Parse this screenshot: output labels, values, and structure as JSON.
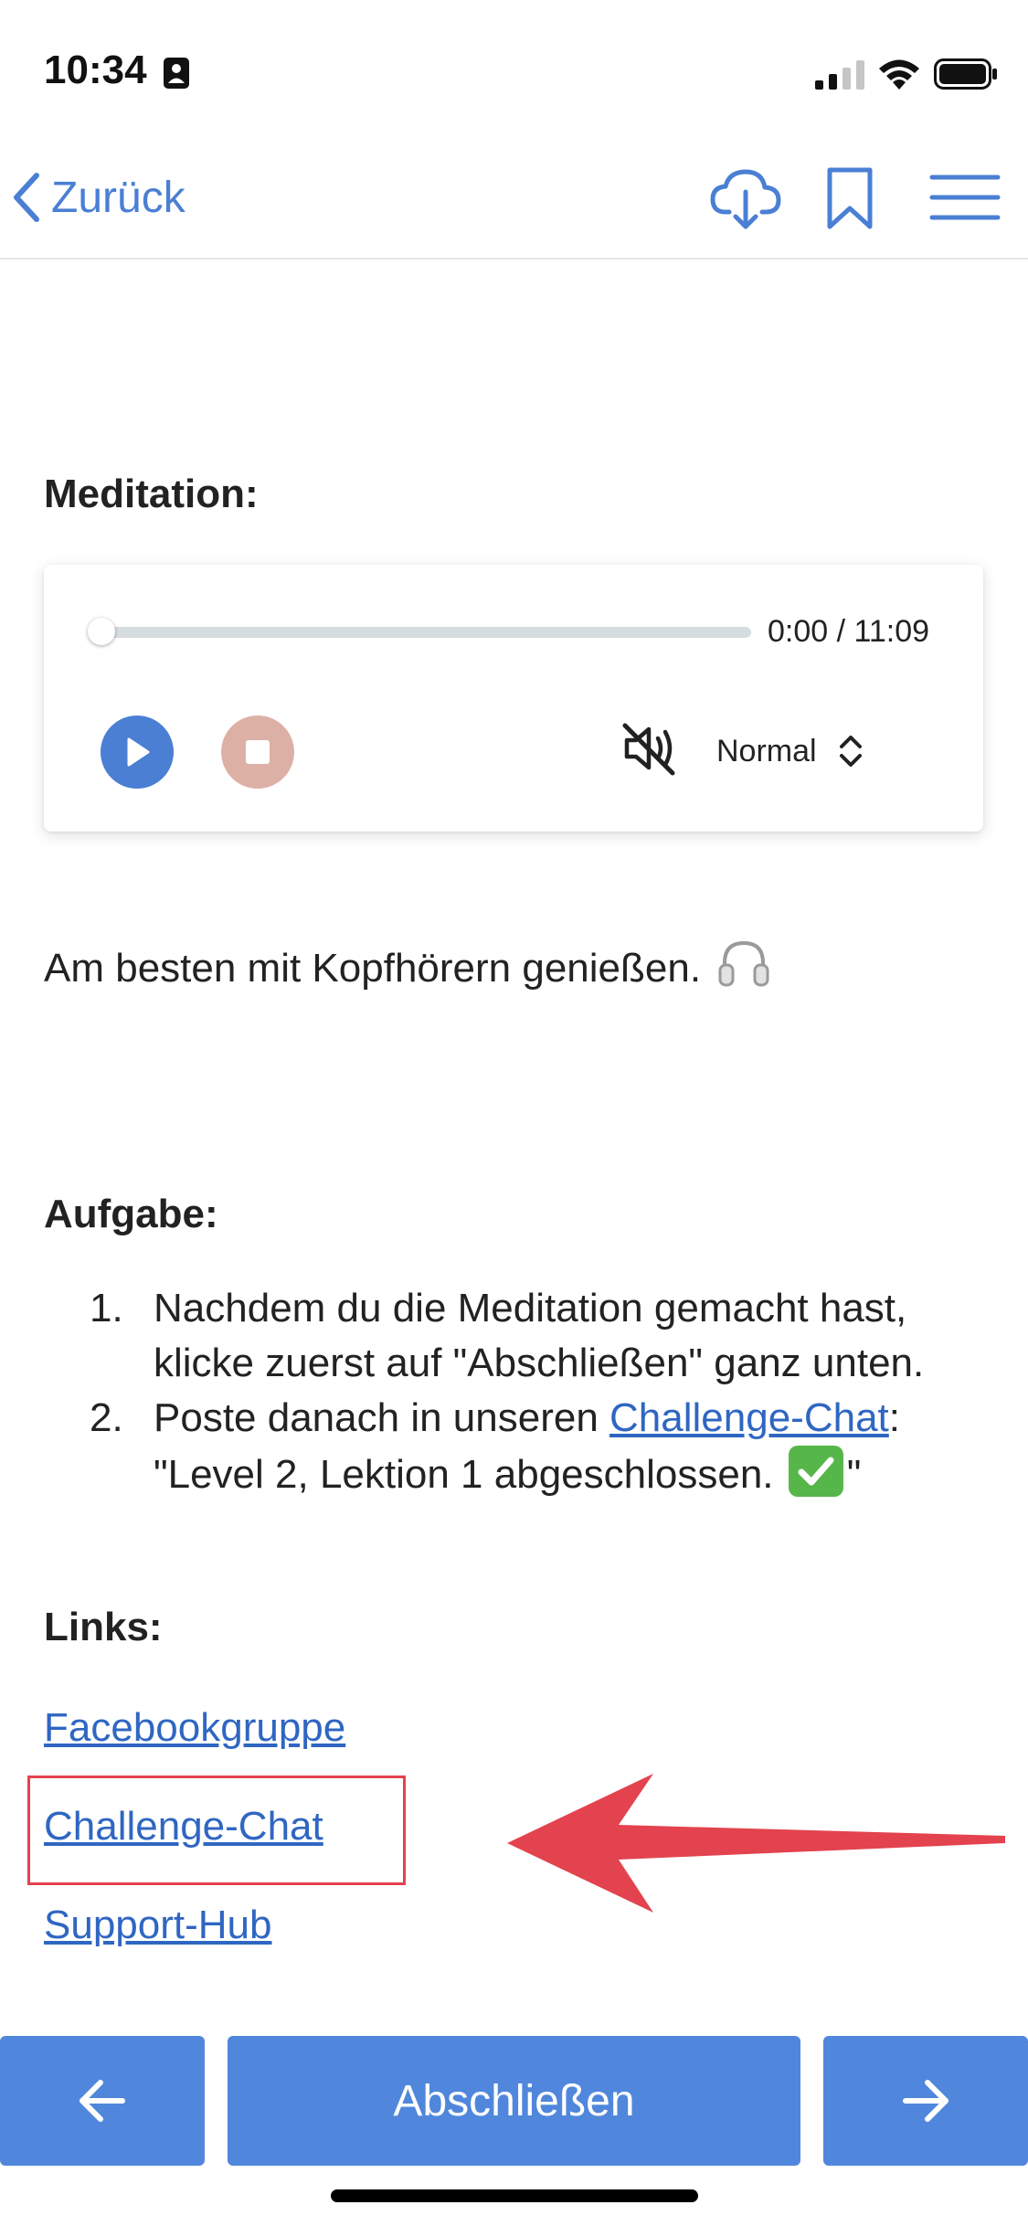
{
  "status_bar": {
    "time": "10:34"
  },
  "nav": {
    "back_label": "Zurück",
    "icons": [
      "cloud-download-icon",
      "bookmark-icon",
      "menu-icon"
    ],
    "accent_color": "#4a7fd4"
  },
  "meditation": {
    "heading": "Meditation:",
    "player": {
      "time": "0:00 / 11:09",
      "progress": 0,
      "muted": true,
      "speed": "Normal"
    },
    "note": "Am besten mit Kopfhörern genießen."
  },
  "task": {
    "heading": "Aufgabe:",
    "items": [
      {
        "number": "1.",
        "text": "Nachdem du die Meditation gemacht hast, klicke zuerst auf \"Abschließen\" ganz unten."
      },
      {
        "number": "2.",
        "text_before": "Poste danach in unseren ",
        "link": "Challenge-Chat",
        "text_after": ":",
        "line2_before": "\"Level 2, Lektion 1 abgeschlossen. ",
        "line2_after": "\""
      }
    ]
  },
  "links": {
    "heading": "Links:",
    "items": [
      "Facebookgruppe",
      "Challenge-Chat",
      "Support-Hub"
    ],
    "highlight_color": "#e3434e"
  },
  "bottom_bar": {
    "complete_label": "Abschließen",
    "button_color": "#5087dc"
  }
}
